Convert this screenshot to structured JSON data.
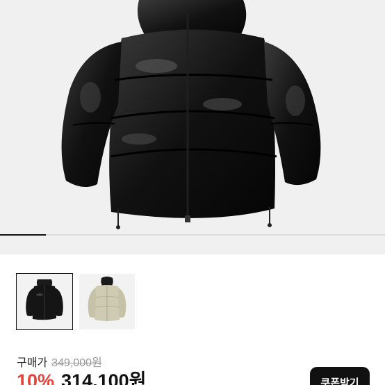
{
  "product": {
    "image_names": [
      "black puffer jacket",
      "beige puffer jacket"
    ],
    "gallery_progress": 0.12,
    "selected_thumbnail": 0
  },
  "price": {
    "label": "구매가",
    "original": "349,000원",
    "discount": "10%",
    "final": "314,100원"
  },
  "actions": {
    "coupon_label": "쿠폰받기"
  },
  "colors": {
    "discount": "#e8423a",
    "button_bg": "#111111",
    "hero_bg": "#f0f0f0"
  }
}
